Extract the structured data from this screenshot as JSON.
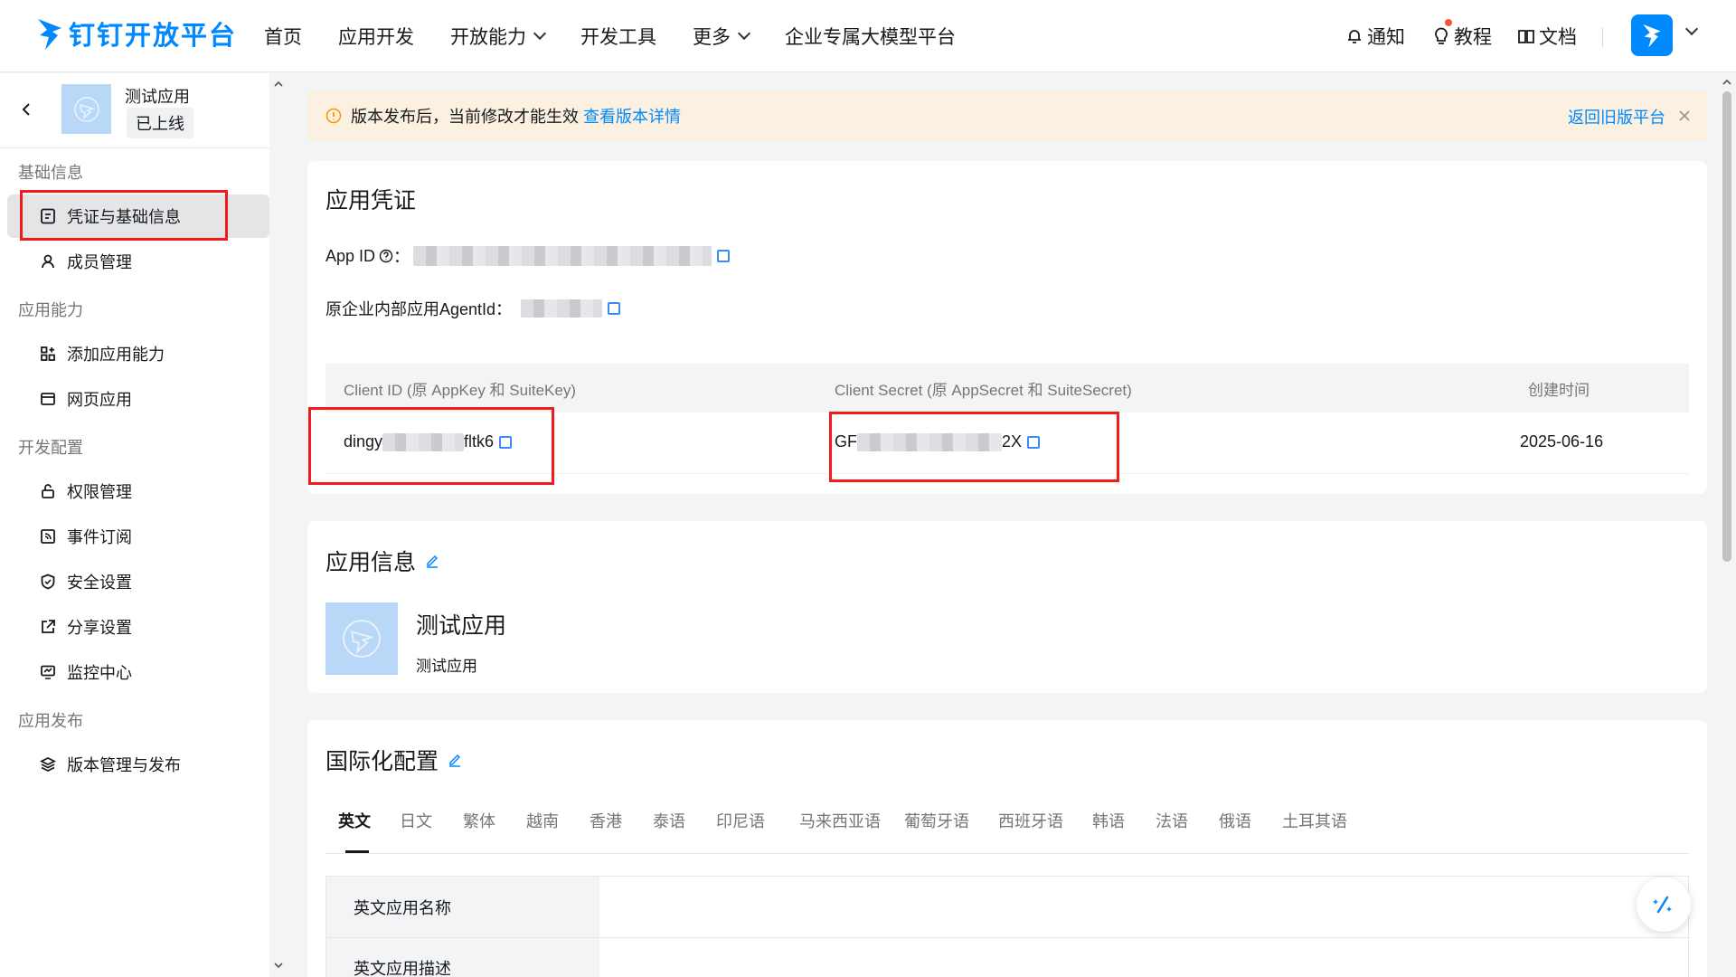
{
  "header": {
    "logo_text": "钉钉开放平台",
    "nav": [
      "首页",
      "应用开发",
      "开放能力",
      "开发工具",
      "更多",
      "企业专属大模型平台"
    ],
    "notify": "通知",
    "tutorial": "教程",
    "docs": "文档"
  },
  "sidebar": {
    "app_name": "测试应用",
    "app_status": "已上线",
    "sections": [
      {
        "title": "基础信息",
        "items": [
          "凭证与基础信息",
          "成员管理"
        ]
      },
      {
        "title": "应用能力",
        "items": [
          "添加应用能力",
          "网页应用"
        ]
      },
      {
        "title": "开发配置",
        "items": [
          "权限管理",
          "事件订阅",
          "安全设置",
          "分享设置",
          "监控中心"
        ]
      },
      {
        "title": "应用发布",
        "items": [
          "版本管理与发布"
        ]
      }
    ]
  },
  "notice": {
    "text": "版本发布后，当前修改才能生效",
    "link": "查看版本详情",
    "back_link": "返回旧版平台"
  },
  "credentials": {
    "title": "应用凭证",
    "app_id_label": "App ID",
    "app_id_colon": "：",
    "agent_label": "原企业内部应用AgentId：",
    "table_headers": [
      "Client ID (原 AppKey 和 SuiteKey)",
      "Client Secret (原 AppSecret 和 SuiteSecret)",
      "创建时间"
    ],
    "client_id_prefix": "dingy",
    "client_id_suffix": "fltk6",
    "client_secret_prefix": "GF",
    "client_secret_suffix": "2X",
    "created": "2025-06-16"
  },
  "app_info": {
    "title": "应用信息",
    "name": "测试应用",
    "desc": "测试应用"
  },
  "i18n": {
    "title": "国际化配置",
    "tabs": [
      "英文",
      "日文",
      "繁体",
      "越南",
      "香港",
      "泰语",
      "印尼语",
      "马来西亚语",
      "葡萄牙语",
      "西班牙语",
      "韩语",
      "法语",
      "俄语",
      "土耳其语"
    ],
    "rows": [
      "英文应用名称",
      "英文应用描述"
    ]
  },
  "colors": {
    "accent": "#0089ff",
    "highlight": "#f21b1b",
    "notice_bg": "#fcf0e1"
  }
}
